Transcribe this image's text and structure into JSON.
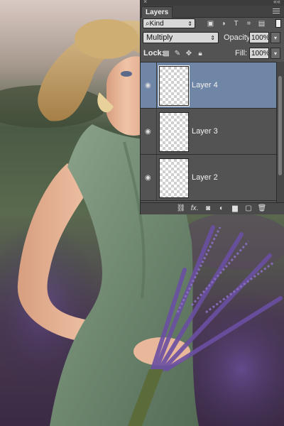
{
  "panel": {
    "tab_label": "Layers",
    "close_glyph": "×",
    "collapse_glyph": "««",
    "filter": {
      "kind_value": "Kind",
      "icon_names": [
        "pixel-layer-filter-icon",
        "adjustment-layer-filter-icon",
        "type-layer-filter-icon",
        "shape-layer-filter-icon",
        "smart-object-filter-icon"
      ]
    },
    "blend_mode": "Multiply",
    "opacity_label": "Opacity:",
    "opacity_value": "100%",
    "lock_label": "Lock:",
    "lock_icons": [
      "lock-transparent-pixels-icon",
      "lock-image-pixels-icon",
      "lock-position-icon",
      "lock-all-icon"
    ],
    "fill_label": "Fill:",
    "fill_value": "100%",
    "layers": [
      {
        "name": "Layer 4",
        "selected": true,
        "visible": true
      },
      {
        "name": "Layer 3",
        "selected": false,
        "visible": true
      },
      {
        "name": "Layer 2",
        "selected": false,
        "visible": true
      }
    ],
    "bottom_icons": [
      "link-layers-icon",
      "fx-icon",
      "add-mask-icon",
      "adjustment-layer-icon",
      "group-folder-icon",
      "new-layer-icon",
      "trash-icon"
    ],
    "selected_color": "#6f86a6"
  }
}
